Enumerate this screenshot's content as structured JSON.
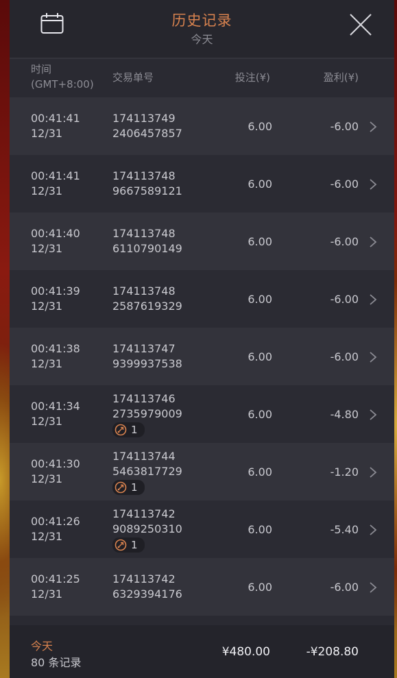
{
  "header": {
    "title": "历史记录",
    "subtitle": "今天"
  },
  "columns": {
    "time_line1": "时间",
    "time_line2": "(GMT+8:00)",
    "id": "交易单号",
    "bet": "投注(¥)",
    "profit": "盈利(¥)"
  },
  "rows": [
    {
      "time": "00:41:41",
      "date": "12/31",
      "id1": "174113749",
      "id2": "2406457857",
      "bet": "6.00",
      "profit": "-6.00",
      "badge": null
    },
    {
      "time": "00:41:41",
      "date": "12/31",
      "id1": "174113748",
      "id2": "9667589121",
      "bet": "6.00",
      "profit": "-6.00",
      "badge": null
    },
    {
      "time": "00:41:40",
      "date": "12/31",
      "id1": "174113748",
      "id2": "6110790149",
      "bet": "6.00",
      "profit": "-6.00",
      "badge": null
    },
    {
      "time": "00:41:39",
      "date": "12/31",
      "id1": "174113748",
      "id2": "2587619329",
      "bet": "6.00",
      "profit": "-6.00",
      "badge": null
    },
    {
      "time": "00:41:38",
      "date": "12/31",
      "id1": "174113747",
      "id2": "9399937538",
      "bet": "6.00",
      "profit": "-6.00",
      "badge": null
    },
    {
      "time": "00:41:34",
      "date": "12/31",
      "id1": "174113746",
      "id2": "2735979009",
      "bet": "6.00",
      "profit": "-4.80",
      "badge": "1"
    },
    {
      "time": "00:41:30",
      "date": "12/31",
      "id1": "174113744",
      "id2": "5463817729",
      "bet": "6.00",
      "profit": "-1.20",
      "badge": "1"
    },
    {
      "time": "00:41:26",
      "date": "12/31",
      "id1": "174113742",
      "id2": "9089250310",
      "bet": "6.00",
      "profit": "-5.40",
      "badge": "1"
    },
    {
      "time": "00:41:25",
      "date": "12/31",
      "id1": "174113742",
      "id2": "6329394176",
      "bet": "6.00",
      "profit": "-6.00",
      "badge": null
    }
  ],
  "footer": {
    "label": "今天",
    "count": "80 条记录",
    "total_bet": "¥480.00",
    "total_profit": "-¥208.80"
  },
  "icons": {
    "calendar": "calendar-icon",
    "close": "close-icon",
    "chevron": "chevron-right-icon",
    "badge": "free-spin-icon"
  },
  "colors": {
    "accent": "#d9834f",
    "panel": "#2a2a32"
  }
}
